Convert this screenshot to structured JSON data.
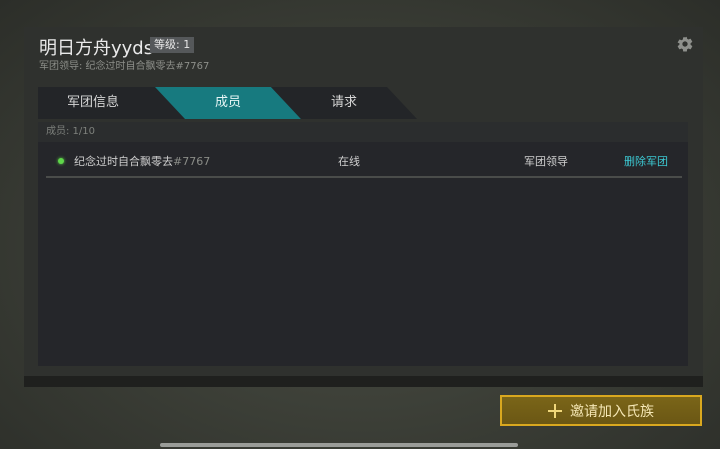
{
  "header": {
    "clan_name": "明日方舟yyds",
    "level_badge": "等级: 1",
    "leader_line": "军团领导: 纪念过时自合飘零去#7767"
  },
  "tabs": [
    {
      "label": "军团信息",
      "active": false
    },
    {
      "label": "成员",
      "active": true
    },
    {
      "label": "请求",
      "active": false
    }
  ],
  "members": {
    "count_label": "成员: 1/10",
    "rows": [
      {
        "name": "纪念过时自合飘零去",
        "tag": "#7767",
        "status": "在线",
        "role": "军团领导",
        "action": "删除军团"
      }
    ]
  },
  "invite_button": {
    "label": "邀请加入氏族"
  },
  "colors": {
    "active_tab": "#177a7f",
    "inactive_tab": "#232528",
    "accent": "#3cc9d3",
    "online": "#5fd64a",
    "button_border": "#d9a81f"
  },
  "icons": [
    "gear-icon",
    "plus-icon",
    "online-status-icon"
  ]
}
